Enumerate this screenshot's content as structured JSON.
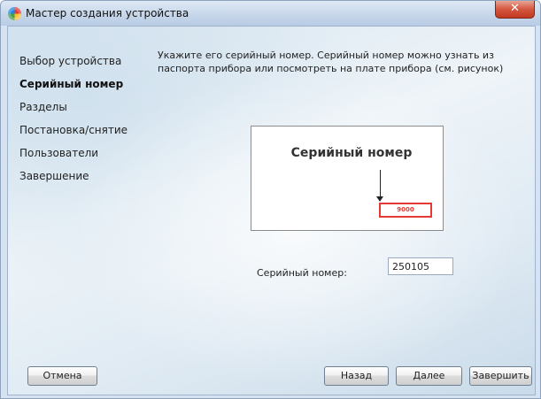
{
  "window": {
    "title": "Мастер создания устройства",
    "close_glyph": "✕",
    "icon": "multicolor-circle-app-icon"
  },
  "nav": {
    "items": [
      {
        "label": "Выбор устройства",
        "active": false
      },
      {
        "label": "Серийный номер",
        "active": true
      },
      {
        "label": "Разделы",
        "active": false
      },
      {
        "label": "Постановка/снятие",
        "active": false
      },
      {
        "label": "Пользователи",
        "active": false
      },
      {
        "label": "Завершение",
        "active": false
      }
    ]
  },
  "main": {
    "instruction": "Укажите его серийный номер. Серийный номер можно узнать из паспорта прибора или посмотреть на плате прибора (см. рисунок)",
    "picture": {
      "title": "Серийный номер",
      "badge_value": "9000",
      "badge_color": "#e53935"
    },
    "serial": {
      "label": "Серийный номер:",
      "value": "250105"
    }
  },
  "buttons": {
    "cancel": "Отмена",
    "back": "Назад",
    "next": "Далее",
    "finish": "Завершить"
  },
  "colors": {
    "accent_close": "#c1381f",
    "highlight_red": "#e53935"
  }
}
